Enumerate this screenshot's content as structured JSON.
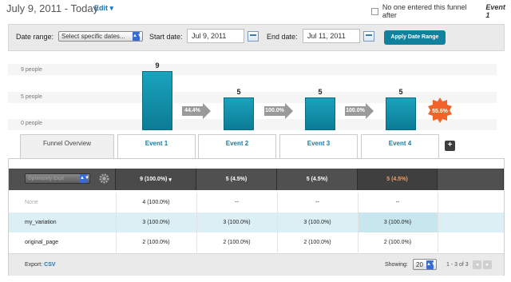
{
  "header": {
    "title": "July 9, 2011 - Today",
    "edit_label": "Edit",
    "funnel_option_text": "No one entered this funnel after",
    "funnel_option_event": "Event 1"
  },
  "date_bar": {
    "date_range_label": "Date range:",
    "date_range_value": "Select specific dates...",
    "start_label": "Start date:",
    "start_value": "Jul 9, 2011",
    "end_label": "End date:",
    "end_value": "Jul 11, 2011",
    "apply_label": "Apply Date Range"
  },
  "chart_data": {
    "type": "bar",
    "ylabels": [
      "9 people",
      "5 people",
      "0 people"
    ],
    "ylim": [
      0,
      9
    ],
    "categories": [
      "Event 1",
      "Event 2",
      "Event 3",
      "Event 4"
    ],
    "values": [
      9,
      5,
      5,
      5
    ],
    "step_conversions": [
      "44.4%",
      "100.0%",
      "100.0%"
    ],
    "overall_conversion": "55.6%"
  },
  "tabs": {
    "overview": "Funnel Overview",
    "events": [
      "Event 1",
      "Event 2",
      "Event 3",
      "Event 4"
    ],
    "add": "+"
  },
  "table": {
    "segment_select": "Optimizely Expt",
    "header": [
      "9 (100.0%)",
      "5 (4.5%)",
      "5 (4.5%)",
      "5 (4.5%)"
    ],
    "rows": [
      {
        "label": "None",
        "cells": [
          "4 (100.0%)",
          "--",
          "--",
          "--"
        ]
      },
      {
        "label": "my_variation",
        "cells": [
          "3 (100.0%)",
          "3 (100.0%)",
          "3 (100.0%)",
          "3 (100.0%)"
        ]
      },
      {
        "label": "original_page",
        "cells": [
          "2 (100.0%)",
          "2 (100.0%)",
          "2 (100.0%)",
          "2 (100.0%)"
        ]
      }
    ],
    "footer": {
      "export_label": "Export:",
      "export_csv": "CSV",
      "showing_label": "Showing:",
      "page_size": "20",
      "range": "1 - 3 of 3"
    }
  },
  "colors": {
    "accent": "#11829d",
    "bar": "#1a9fb9",
    "badge": "#f2632a",
    "highlight_text": "#ff9a57"
  }
}
